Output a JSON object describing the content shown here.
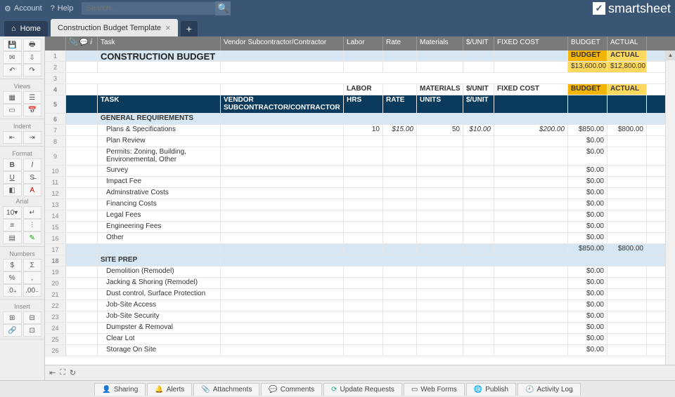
{
  "topbar": {
    "account": "Account",
    "help": "Help",
    "search_ph": "Search...",
    "brand": "smartsheet"
  },
  "tabs": {
    "home": "Home",
    "active": "Construction Budget Template"
  },
  "leftbar": {
    "views": "Views",
    "indent": "Indent",
    "format": "Format",
    "arial": "Arial",
    "numbers": "Numbers",
    "insert": "Insert"
  },
  "colhead": {
    "task": "Task",
    "vendor": "Vendor Subcontractor/Contractor",
    "labor": "Labor",
    "rate": "Rate",
    "materials": "Materials",
    "unit": "$/UNIT",
    "fixed": "FIXED COST",
    "budget": "BUDGET",
    "actual": "ACTUAL"
  },
  "title": "CONSTRUCTION BUDGET",
  "totals": {
    "budget_label": "BUDGET",
    "actual_label": "ACTUAL",
    "budget": "$13,600.00",
    "actual": "$12,800.00"
  },
  "subhead2": {
    "labor": "LABOR",
    "materials": "MATERIALS",
    "unit": "$/UNIT",
    "fixed": "FIXED COST",
    "budget": "BUDGET",
    "actual": "ACTUAL"
  },
  "subhead": {
    "task": "TASK",
    "vendor": "VENDOR SUBCONTRACTOR/CONTRACTOR",
    "hrs": "HRS",
    "rate": "RATE",
    "units": "UNITS",
    "unit": "$/UNIT"
  },
  "sections": {
    "gen": "GENERAL REQUIREMENTS",
    "site": "SITE PREP"
  },
  "gen_rows": [
    {
      "n": "7",
      "task": "Plans & Specifications",
      "hrs": "10",
      "rate": "$15.00",
      "units": "50",
      "unit": "$10.00",
      "fixed": "$200.00",
      "budget": "$850.00",
      "actual": "$800.00"
    },
    {
      "n": "8",
      "task": "Plan Review",
      "budget": "$0.00"
    },
    {
      "n": "9",
      "task": "Permits: Zoning, Building, Environemental, Other",
      "budget": "$0.00",
      "tall": true
    },
    {
      "n": "10",
      "task": "Survey",
      "budget": "$0.00"
    },
    {
      "n": "11",
      "task": "Impact Fee",
      "budget": "$0.00"
    },
    {
      "n": "12",
      "task": "Adminstrative Costs",
      "budget": "$0.00"
    },
    {
      "n": "13",
      "task": "Financing Costs",
      "budget": "$0.00"
    },
    {
      "n": "14",
      "task": "Legal Fees",
      "budget": "$0.00"
    },
    {
      "n": "15",
      "task": "Engineering Fees",
      "budget": "$0.00"
    },
    {
      "n": "16",
      "task": "Other",
      "budget": "$0.00"
    }
  ],
  "gen_subtotal": {
    "n": "17",
    "budget": "$850.00",
    "actual": "$800.00"
  },
  "site_rows": [
    {
      "n": "19",
      "task": "Demolition (Remodel)",
      "budget": "$0.00"
    },
    {
      "n": "20",
      "task": "Jacking & Shoring (Remodel)",
      "budget": "$0.00"
    },
    {
      "n": "21",
      "task": "Dust control, Surface Protection",
      "budget": "$0.00"
    },
    {
      "n": "22",
      "task": "Job-Site Access",
      "budget": "$0.00"
    },
    {
      "n": "23",
      "task": "Job-Site Security",
      "budget": "$0.00"
    },
    {
      "n": "24",
      "task": "Dumpster & Removal",
      "budget": "$0.00"
    },
    {
      "n": "25",
      "task": "Clear Lot",
      "budget": "$0.00"
    },
    {
      "n": "26",
      "task": "Storage On Site",
      "budget": "$0.00"
    }
  ],
  "bottom": {
    "sharing": "Sharing",
    "alerts": "Alerts",
    "attachments": "Attachments",
    "comments": "Comments",
    "update": "Update Requests",
    "forms": "Web Forms",
    "publish": "Publish",
    "log": "Activity Log"
  }
}
